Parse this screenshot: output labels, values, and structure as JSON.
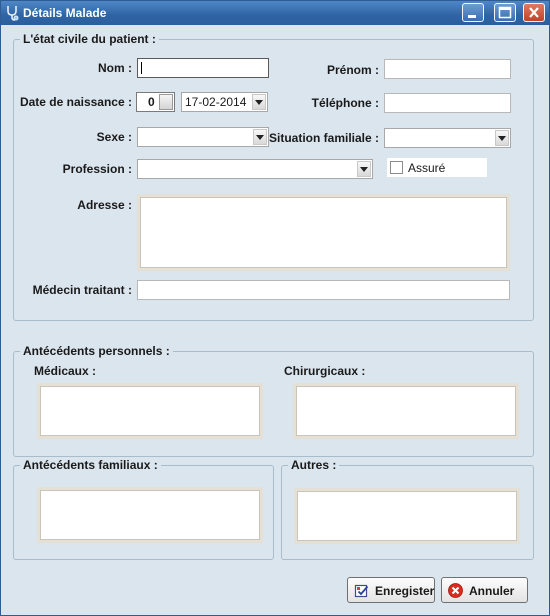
{
  "window": {
    "title": "Détails Malade",
    "icons": {
      "app": "stethoscope-icon",
      "minimize": "minimize-icon",
      "maximize": "maximize-icon",
      "close": "close-icon"
    }
  },
  "patient_group": {
    "legend": "L'état civile du patient :",
    "nom_label": "Nom :",
    "nom_value": "",
    "prenom_label": "Prénom :",
    "prenom_value": "",
    "date_label": "Date de naissance :",
    "age_value": "0",
    "date_value": "17-02-2014",
    "telephone_label": "Téléphone :",
    "telephone_value": "",
    "sexe_label": "Sexe :",
    "sexe_value": "",
    "situation_label": "Situation familiale :",
    "situation_value": "",
    "profession_label": "Profession :",
    "profession_value": "",
    "assure_label": "Assuré",
    "assure_checked": false,
    "adresse_label": "Adresse :",
    "adresse_value": "",
    "medecin_label": "Médecin traitant :",
    "medecin_value": ""
  },
  "antecedents_personnels": {
    "legend": "Antécédents personnels :",
    "medicaux_label": "Médicaux :",
    "chirurgicaux_label": "Chirurgicaux :"
  },
  "antecedents_familiaux": {
    "legend": "Antécédents familiaux :"
  },
  "autres": {
    "legend": "Autres :"
  },
  "buttons": {
    "save_label": "Enregister",
    "save_icon": "save-check-icon",
    "cancel_label": "Annuler",
    "cancel_icon": "cancel-x-icon"
  },
  "colors": {
    "window_bg": "#dbe5ee",
    "titlebar": "#2f64a4",
    "close_button": "#c14326"
  }
}
